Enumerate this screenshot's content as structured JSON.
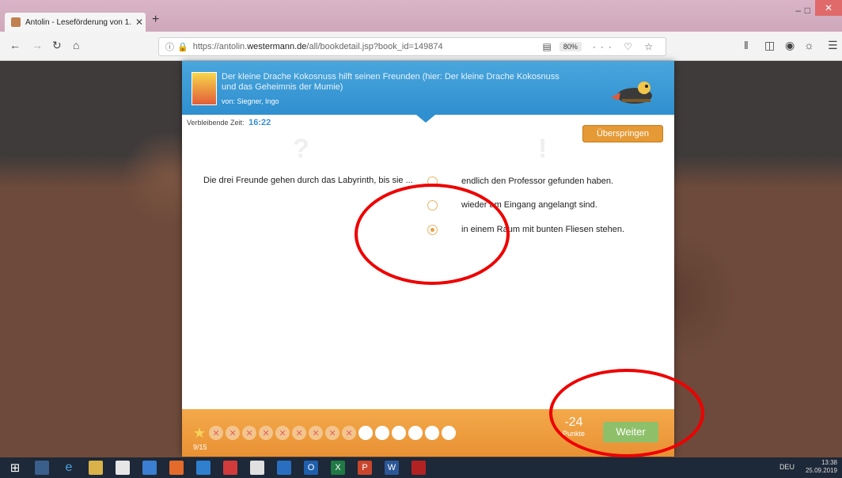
{
  "browser": {
    "tab_title": "Antolin - Leseförderung von 1.",
    "tab_close": "✕",
    "new_tab": "+",
    "url_prefix": "https://antolin.",
    "url_domain": "westermann.de",
    "url_path": "/all/bookdetail.jsp?book_id=149874",
    "zoom": "80%",
    "url_more": "··· ♡ ☆"
  },
  "book": {
    "title": "Der kleine Drache Kokosnuss hilft seinen Freunden (hier: Der kleine Drache Kokosnuss und das Geheimnis der Mumie)",
    "author": "von: Siegner, Ingo"
  },
  "timer": {
    "label": "Verbleibende Zeit:",
    "value": "16:22"
  },
  "skip_label": "Überspringen",
  "question": "Die drei Freunde gehen durch das Labyrinth, bis sie ...",
  "answers": [
    {
      "text": "endlich den Professor gefunden haben.",
      "selected": false
    },
    {
      "text": "wieder am Eingang angelangt sind.",
      "selected": false
    },
    {
      "text": "in einem Raum mit bunten Fliesen stehen.",
      "selected": true
    }
  ],
  "progress": {
    "wrong_mark": "✕",
    "wrong_count": 9,
    "open_count": 6,
    "count_text": "9/15"
  },
  "score": {
    "value": "-24",
    "label": "Punkte"
  },
  "next_label": "Weiter",
  "taskbar": {
    "lang": "DEU",
    "time": "13:38",
    "date": "25.09.2019"
  },
  "colors": {
    "header_blue": "#3a9ad6",
    "accent_orange": "#e89134",
    "next_green": "#8ec06a",
    "annotation_red": "#e00000"
  }
}
